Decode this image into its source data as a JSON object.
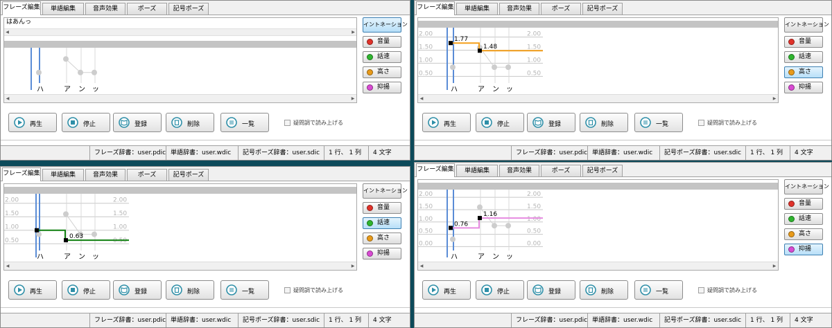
{
  "tabs": [
    "フレーズ編集",
    "単語編集",
    "音声効果",
    "ポーズ",
    "記号ポーズ"
  ],
  "intonation_label": "イントネーション",
  "side_buttons": [
    {
      "label": "音量",
      "color": "#e0322a"
    },
    {
      "label": "話速",
      "color": "#2fb52f"
    },
    {
      "label": "高さ",
      "color": "#e89a1a"
    },
    {
      "label": "抑揚",
      "color": "#d94bd3"
    }
  ],
  "toolbar": {
    "play": "再生",
    "stop": "停止",
    "register": "登録",
    "delete": "削除",
    "list": "一覧",
    "question_checkbox": "疑問調で読み上げる",
    "icons": [
      "play-icon",
      "stop-icon",
      "book-icon",
      "trash-icon",
      "list-icon"
    ]
  },
  "status": {
    "phrase_dict": "フレーズ辞書：user.pdic",
    "word_dict": "単語辞書：user.wdic",
    "symbol_dict": "記号ポーズ辞書：user.sdic",
    "position": "1 行、 1 列",
    "chars": "4 文字"
  },
  "phonemes": [
    "ハ",
    "ア",
    "ン",
    "ッ"
  ],
  "panels": [
    {
      "mode": "intonation",
      "text": "はあんっ",
      "axis_labels": [],
      "annotations": [],
      "lines": []
    },
    {
      "mode": "pitch",
      "text": "",
      "axis_labels": [
        "2.00",
        "1.50",
        "1.00",
        "0.50"
      ],
      "annotations": [
        "1.77",
        "1.48"
      ],
      "lines": [
        {
          "x": [
            0,
            1,
            1,
            3
          ],
          "y": [
            1.77,
            1.77,
            1.48,
            1.48
          ],
          "color": "#f59f1a"
        }
      ]
    },
    {
      "mode": "speed",
      "text": "",
      "axis_labels": [
        "2.00",
        "1.50",
        "1.00",
        "0.50"
      ],
      "annotations": [
        "0.63"
      ],
      "lines": [
        {
          "x": [
            0,
            1,
            1,
            3
          ],
          "y": [
            1.0,
            1.0,
            0.63,
            0.63
          ],
          "color": "#0f7f0f"
        }
      ]
    },
    {
      "mode": "intonation_strength",
      "text": "",
      "axis_labels": [
        "2.00",
        "1.50",
        "1.00",
        "0.50",
        "0.00"
      ],
      "annotations": [
        "0.76",
        "1.16"
      ],
      "lines": [
        {
          "x": [
            0,
            1,
            1,
            3
          ],
          "y": [
            0.76,
            0.76,
            1.16,
            1.16
          ],
          "color": "#e68ae0"
        }
      ]
    }
  ]
}
